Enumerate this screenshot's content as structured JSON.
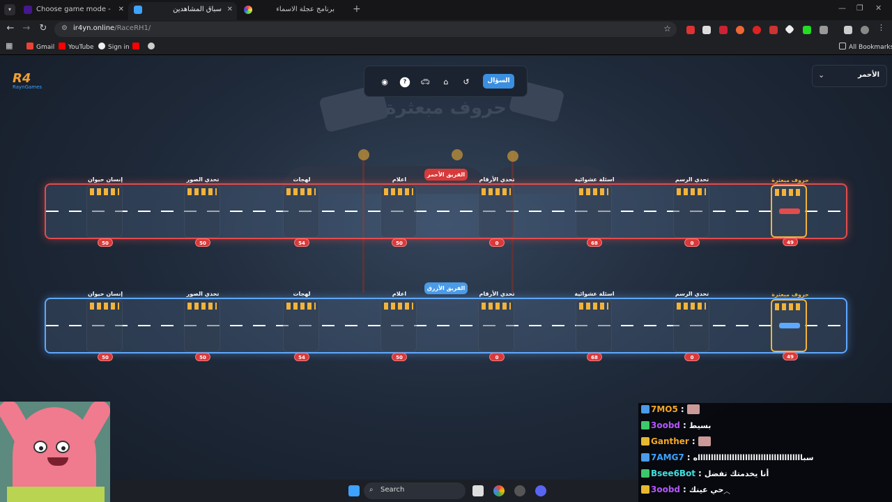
{
  "browser": {
    "tabs": [
      {
        "title": "Choose game mode - Kahoot!",
        "active": false
      },
      {
        "title": "سباق المشاهدين",
        "active": true
      },
      {
        "title": "برنامج عجلة الاسماء",
        "active": false
      }
    ],
    "url_domain": "ir4yn.online",
    "url_path": "/RaceRH1/",
    "bookmarks": [
      "Gmail",
      "YouTube",
      "Sign in"
    ],
    "all_bookmarks": "All Bookmarks",
    "new_tab_symbol": "+",
    "close_symbol": "✕"
  },
  "app": {
    "logo_mark": "R4",
    "logo_text": "RaynGames",
    "question_button": "السؤال",
    "team_select_value": "الأحمر",
    "big_title": "حروف مبعثرة",
    "icons": [
      "eye-icon",
      "help-icon",
      "car-icon",
      "home-icon",
      "refresh-icon"
    ]
  },
  "race": {
    "stops": [
      {
        "label": "إنسان حيوان"
      },
      {
        "label": "تحدي الصور"
      },
      {
        "label": "لهجات"
      },
      {
        "label": "اعلام"
      },
      {
        "label": "تحدي الأرقام"
      },
      {
        "label": "اسئلة عشوائية"
      },
      {
        "label": "تحدي الرسم"
      },
      {
        "label": "حروف مبعثرة"
      }
    ],
    "current_stop_index": 7,
    "teams": [
      {
        "name": "الفريق الأحمر",
        "color": "#e24c4c",
        "scores": [
          "50",
          "50",
          "54",
          "50",
          "0",
          "68",
          "0",
          "49"
        ]
      },
      {
        "name": "الفريق الأزرق",
        "color": "#5ea8ff",
        "scores": [
          "50",
          "50",
          "54",
          "50",
          "0",
          "68",
          "0",
          "49"
        ]
      }
    ]
  },
  "chat": {
    "messages": [
      {
        "user": "7MO5",
        "color": "#f5a623",
        "sep": ":",
        "text": "",
        "emote": true
      },
      {
        "user": "3oobd",
        "color": "#b455ff",
        "sep": ":",
        "text": "بسيط",
        "emote": false
      },
      {
        "user": "Ganther",
        "color": "#f5a623",
        "sep": ":",
        "text": "",
        "emote": true
      },
      {
        "user": "7AMG7",
        "color": "#3da3ff",
        "sep": ":",
        "text": "سبااااااااااااااااااااااااااااااااااااااااه",
        "emote": false
      },
      {
        "user": "Bsee6Bot",
        "color": "#3de0e0",
        "sep": ":",
        "text": "أنا يخدمتك تفضل",
        "emote": false
      },
      {
        "user": "3oobd",
        "color": "#b455ff",
        "sep": ":",
        "text": "حي عينك",
        "emote": false
      }
    ]
  },
  "taskbar": {
    "search_label": "Search"
  }
}
